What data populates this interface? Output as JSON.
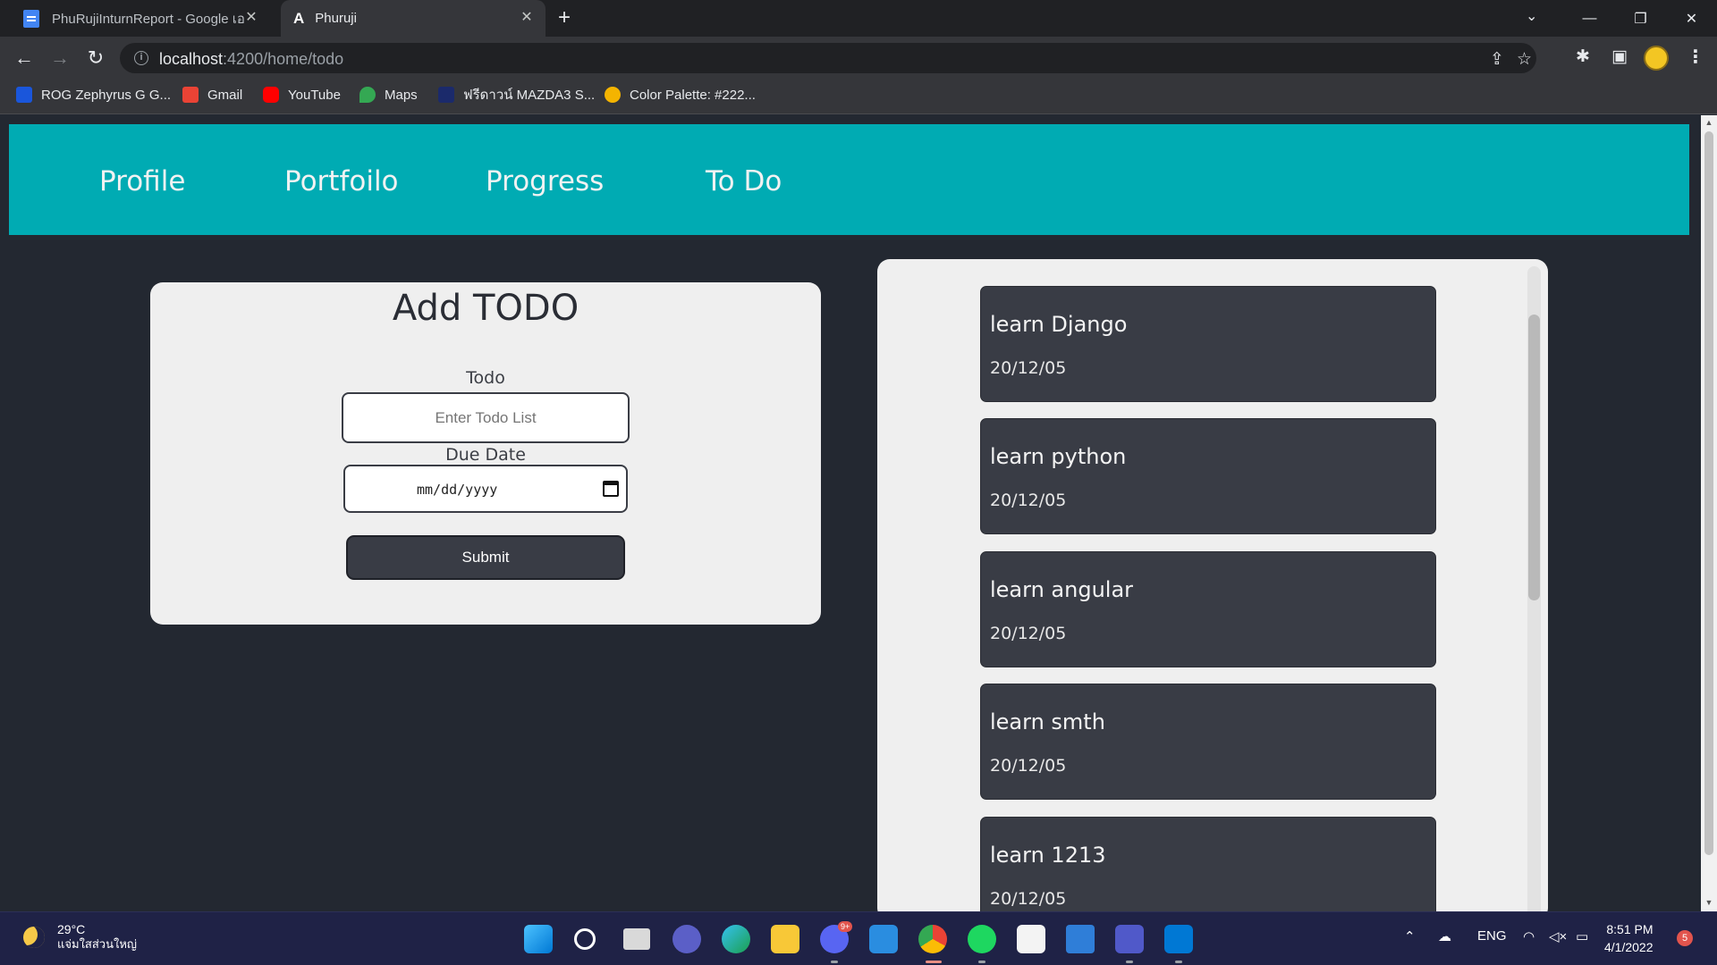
{
  "browser": {
    "tabs": [
      {
        "title": "PhuRujiInturnReport - Google เอ",
        "icon": "google-docs-icon"
      },
      {
        "title": "Phuruji",
        "icon": "angular-icon"
      }
    ],
    "url_host": "localhost",
    "url_path": ":4200/home/todo",
    "bookmarks": [
      {
        "label": "ROG Zephyrus G G...",
        "icon": "rog-icon"
      },
      {
        "label": "Gmail",
        "icon": "gmail-icon"
      },
      {
        "label": "YouTube",
        "icon": "youtube-icon"
      },
      {
        "label": "Maps",
        "icon": "maps-icon"
      },
      {
        "label": "ฟรีดาวน์ MAZDA3 S...",
        "icon": "k-icon"
      },
      {
        "label": "Color Palette: #222...",
        "icon": "palette-icon"
      }
    ]
  },
  "nav": {
    "items": [
      "Profile",
      "Portfoilo",
      "Progress",
      "To Do"
    ]
  },
  "add_todo": {
    "title": "Add TODO",
    "todo_label": "Todo",
    "todo_placeholder": "Enter Todo List",
    "due_label": "Due Date",
    "date_placeholder": "mm/dd/yyyy",
    "submit_label": "Submit"
  },
  "todos": [
    {
      "title": "learn Django",
      "date": "20/12/05"
    },
    {
      "title": "learn python",
      "date": "20/12/05"
    },
    {
      "title": "learn angular",
      "date": "20/12/05"
    },
    {
      "title": "learn smth",
      "date": "20/12/05"
    },
    {
      "title": "learn 1213",
      "date": "20/12/05"
    }
  ],
  "taskbar": {
    "temperature": "29°C",
    "weather_condition": "แจ่มใสส่วนใหญ่",
    "language": "ENG",
    "time": "8:51 PM",
    "date": "4/1/2022",
    "notification_count": "5",
    "discord_badge": "9+"
  },
  "colors": {
    "navbar": "#00abb3",
    "background": "#232831",
    "card": "#efefef",
    "item": "#393c45"
  }
}
